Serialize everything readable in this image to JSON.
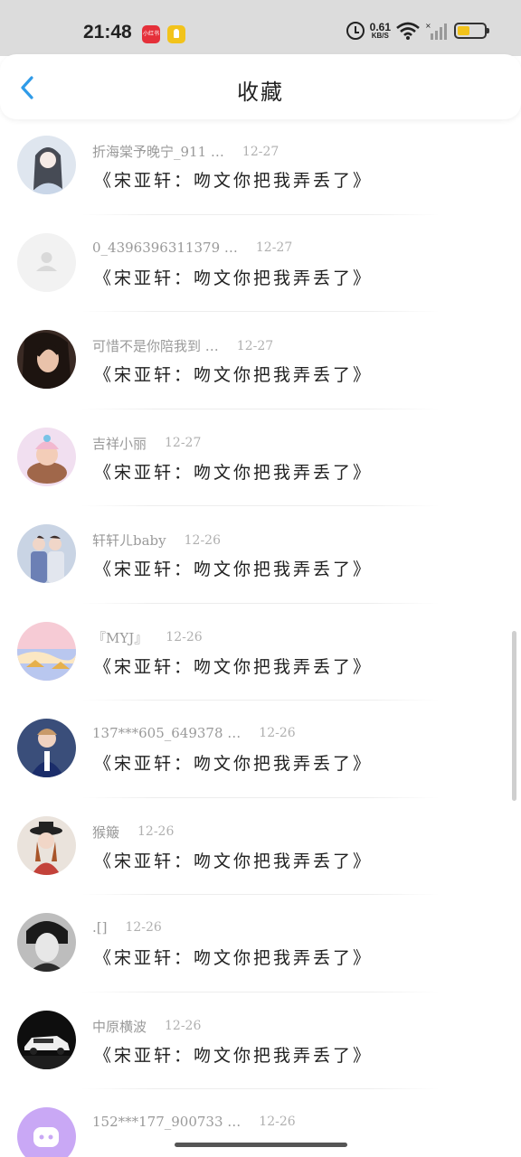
{
  "status_bar": {
    "time": "21:48",
    "net_speed_value": "0.61",
    "net_speed_unit": "KB/S",
    "battery_level": 0.45,
    "badge_red_text": "小红书"
  },
  "header": {
    "title": "收藏"
  },
  "items": [
    {
      "name": "折海棠予晚宁_911 …",
      "date": "12-27",
      "content": "《宋亚轩：吻文你把我弄丢了》",
      "avatar": "girl-anime"
    },
    {
      "name": "0_4396396311379 …",
      "date": "12-27",
      "content": "《宋亚轩：吻文你把我弄丢了》",
      "avatar": "default"
    },
    {
      "name": "可惜不是你陪我到 …",
      "date": "12-27",
      "content": "《宋亚轩：吻文你把我弄丢了》",
      "avatar": "woman"
    },
    {
      "name": "吉祥小丽",
      "date": "12-27",
      "content": "《宋亚轩：吻文你把我弄丢了》",
      "avatar": "baby"
    },
    {
      "name": "轩轩ㄦbaby",
      "date": "12-26",
      "content": "《宋亚轩：吻文你把我弄丢了》",
      "avatar": "two-boys"
    },
    {
      "name": "『MYJ』",
      "date": "12-26",
      "content": "《宋亚轩：吻文你把我弄丢了》",
      "avatar": "sky"
    },
    {
      "name": "137***605_649378 …",
      "date": "12-26",
      "content": "《宋亚轩：吻文你把我弄丢了》",
      "avatar": "boy-blue"
    },
    {
      "name": "猴簸",
      "date": "12-26",
      "content": "《宋亚轩：吻文你把我弄丢了》",
      "avatar": "girl-hat"
    },
    {
      "name": ".[]",
      "date": "12-26",
      "content": "《宋亚轩：吻文你把我弄丢了》",
      "avatar": "boy-bw"
    },
    {
      "name": "中原横波",
      "date": "12-26",
      "content": "《宋亚轩：吻文你把我弄丢了》",
      "avatar": "car"
    },
    {
      "name": "152***177_900733 …",
      "date": "12-26",
      "content": "",
      "avatar": "purple"
    }
  ],
  "scroll_position": 0.6
}
